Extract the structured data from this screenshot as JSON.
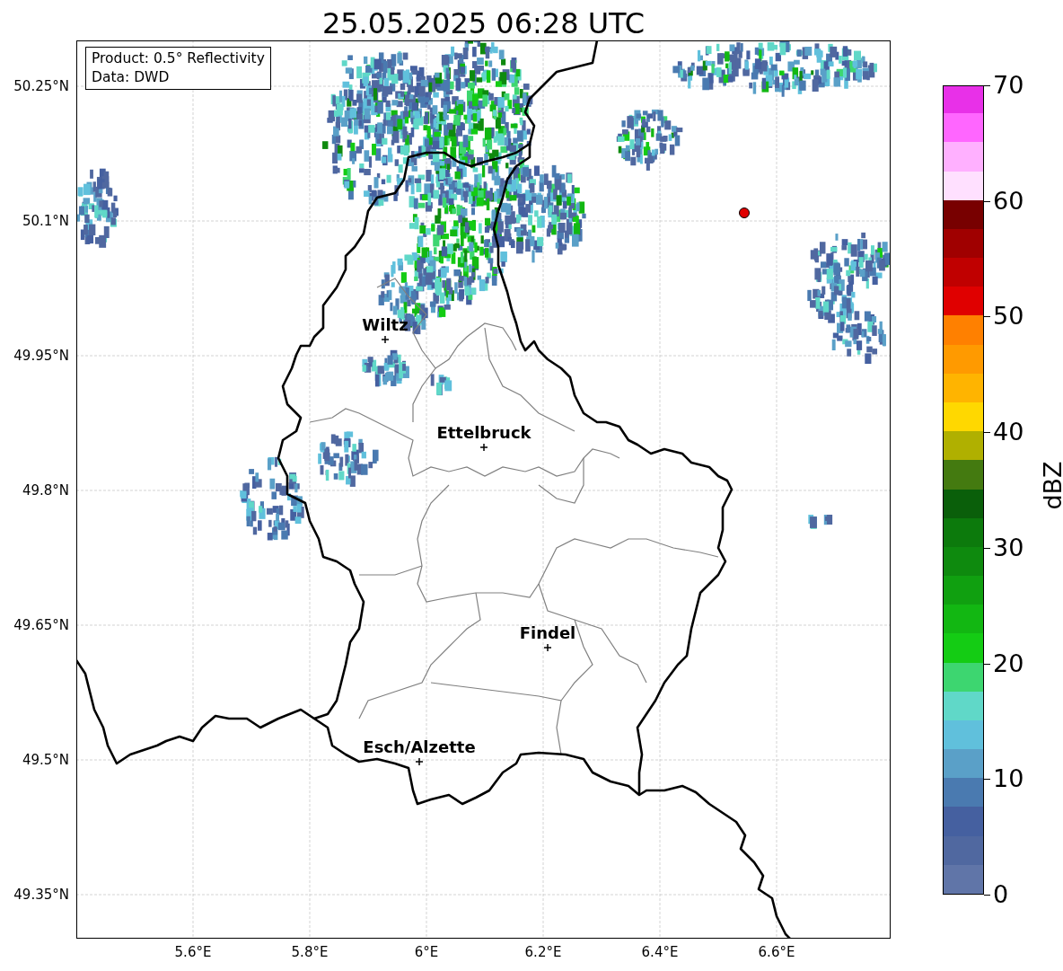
{
  "title": "25.05.2025 06:28 UTC",
  "legend": [
    "Product: 0.5° Reflectivity",
    "Data: DWD"
  ],
  "map": {
    "yticks": [
      "50.25°N",
      "50.1°N",
      "49.95°N",
      "49.8°N",
      "49.65°N",
      "49.5°N",
      "49.35°N"
    ],
    "xticks": [
      "5.6°E",
      "5.8°E",
      "6°E",
      "6.2°E",
      "6.4°E",
      "6.6°E"
    ],
    "cities": [
      "Wiltz",
      "Ettelbruck",
      "Findel",
      "Esch/Alzette"
    ]
  },
  "colorbar": {
    "label": "dBZ",
    "ticks": [
      "70",
      "60",
      "50",
      "40",
      "30",
      "20",
      "10",
      "0"
    ],
    "bins": [
      {
        "color": "#6075a8"
      },
      {
        "color": "#5068a0"
      },
      {
        "color": "#4560a0"
      },
      {
        "color": "#4a7ab0"
      },
      {
        "color": "#5aa0c8"
      },
      {
        "color": "#60c0dc"
      },
      {
        "color": "#60d8c8"
      },
      {
        "color": "#3dd670"
      },
      {
        "color": "#14cc14"
      },
      {
        "color": "#12b712"
      },
      {
        "color": "#10a010"
      },
      {
        "color": "#0e8a0e"
      },
      {
        "color": "#0c7a0c"
      },
      {
        "color": "#0a5f0a"
      },
      {
        "color": "#447a10"
      },
      {
        "color": "#b0b000"
      },
      {
        "color": "#ffd800"
      },
      {
        "color": "#ffb400"
      },
      {
        "color": "#ff9a00"
      },
      {
        "color": "#ff8000"
      },
      {
        "color": "#e00000"
      },
      {
        "color": "#c00000"
      },
      {
        "color": "#a00000"
      },
      {
        "color": "#780000"
      },
      {
        "color": "#ffe0ff"
      },
      {
        "color": "#ffb0ff"
      },
      {
        "color": "#ff66ff"
      },
      {
        "color": "#e830e8"
      }
    ]
  }
}
